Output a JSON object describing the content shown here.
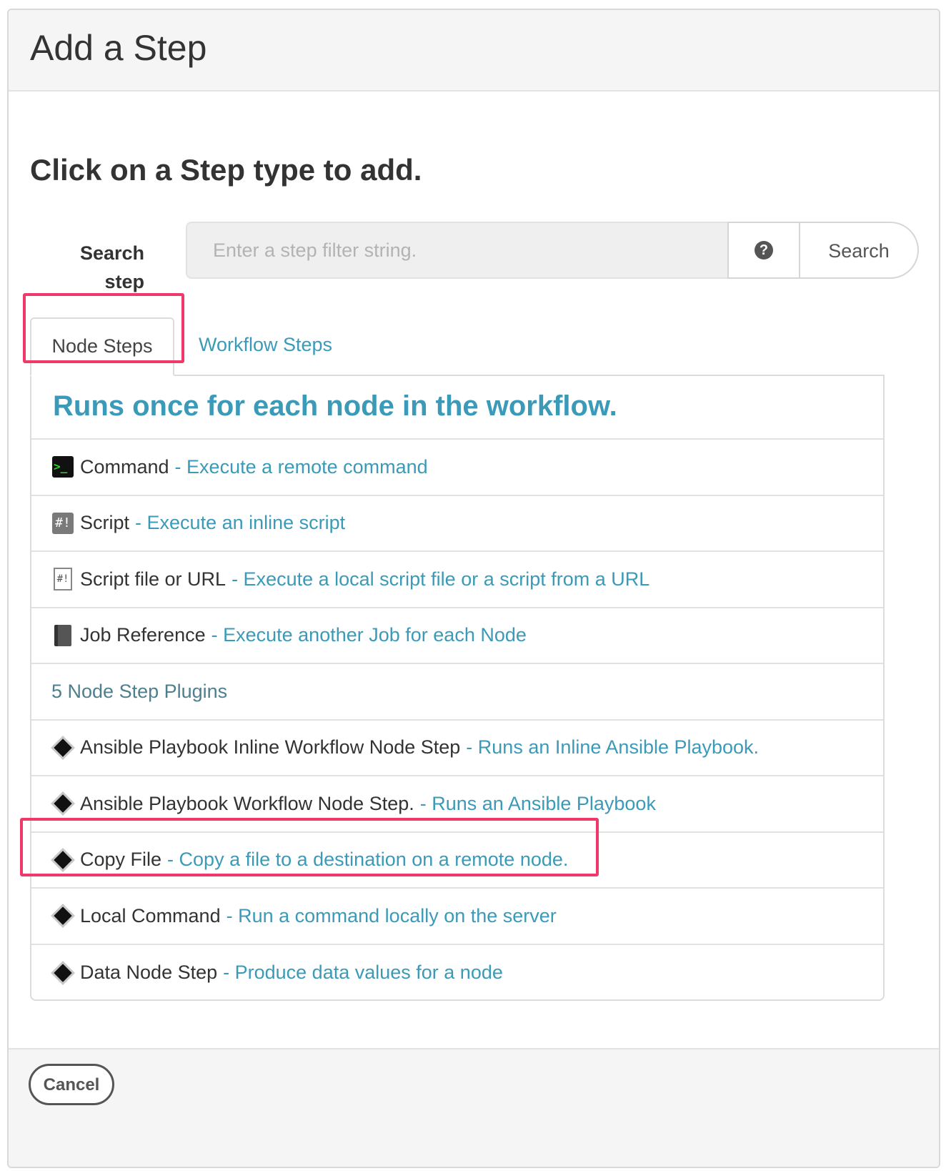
{
  "modal": {
    "title": "Add a Step",
    "instruction": "Click on a Step type to add."
  },
  "search": {
    "label_line1": "Search",
    "label_line2": "step",
    "placeholder": "Enter a step filter string.",
    "help_icon": "question-circle-icon",
    "button_label": "Search"
  },
  "tabs": [
    {
      "label": "Node Steps",
      "active": true
    },
    {
      "label": "Workflow Steps",
      "active": false
    }
  ],
  "panel": {
    "heading": "Runs once for each node in the workflow.",
    "builtin_steps": [
      {
        "icon": "terminal-icon",
        "title": "Command",
        "desc": "- Execute a remote command"
      },
      {
        "icon": "script-icon",
        "title": "Script",
        "desc": "- Execute an inline script"
      },
      {
        "icon": "script-file-icon",
        "title": "Script file or URL",
        "desc": "- Execute a local script file or a script from a URL"
      },
      {
        "icon": "book-icon",
        "title": "Job Reference",
        "desc": "- Execute another Job for each Node"
      }
    ],
    "plugins_header": "5 Node Step Plugins",
    "plugin_steps": [
      {
        "icon": "diamond-icon",
        "title": "Ansible Playbook Inline Workflow Node Step",
        "desc": "- Runs an Inline Ansible Playbook."
      },
      {
        "icon": "diamond-icon",
        "title": "Ansible Playbook Workflow Node Step.",
        "desc": "- Runs an Ansible Playbook"
      },
      {
        "icon": "diamond-icon",
        "title": "Copy File",
        "desc": "- Copy a file to a destination on a remote node."
      },
      {
        "icon": "diamond-icon",
        "title": "Local Command",
        "desc": "- Run a command locally on the server"
      },
      {
        "icon": "diamond-icon",
        "title": "Data Node Step",
        "desc": "- Produce data values for a node"
      }
    ]
  },
  "footer": {
    "cancel_label": "Cancel"
  },
  "colors": {
    "accent": "#3b9ab8",
    "highlight": "#f0386b",
    "header_bg": "#f5f5f5"
  }
}
